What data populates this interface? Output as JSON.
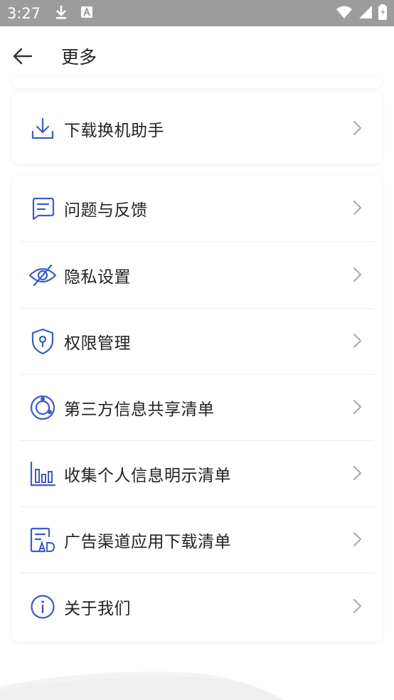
{
  "status_bar": {
    "time": "3:27"
  },
  "header": {
    "title": "更多"
  },
  "single_item": {
    "label": "下载换机助手",
    "icon": "download-icon"
  },
  "list_items": [
    {
      "label": "问题与反馈",
      "icon": "feedback-icon"
    },
    {
      "label": "隐私设置",
      "icon": "eye-off-icon"
    },
    {
      "label": "权限管理",
      "icon": "shield-icon"
    },
    {
      "label": "第三方信息共享清单",
      "icon": "orbit-icon"
    },
    {
      "label": "收集个人信息明示清单",
      "icon": "bar-chart-icon"
    },
    {
      "label": "广告渠道应用下载清单",
      "icon": "ad-document-icon"
    },
    {
      "label": "关于我们",
      "icon": "info-icon"
    }
  ],
  "colors": {
    "accent": "#3d5cc4",
    "statusbar": "#9c9c9c",
    "chevron": "#a8a8a8",
    "text": "#222222"
  }
}
